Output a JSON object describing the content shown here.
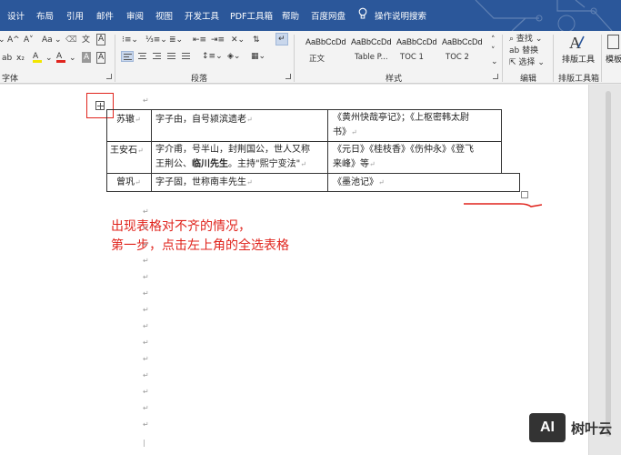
{
  "ribbon_tabs": [
    "设计",
    "布局",
    "引用",
    "邮件",
    "审阅",
    "视图",
    "开发工具",
    "PDF工具箱",
    "帮助",
    "百度网盘"
  ],
  "tell_me": "操作说明搜索",
  "font_group": {
    "label": "字体",
    "grow_label": "A^",
    "shrink_label": "A˅",
    "case_label": "Aa",
    "highlight_label": "A",
    "font_color_label": "A",
    "char_shade_label": "A",
    "char_border_label": "A"
  },
  "paragraph_group": {
    "label": "段落"
  },
  "styles_group": {
    "label": "样式",
    "styles": [
      {
        "sample": "AaBbCcDd",
        "name": "正文"
      },
      {
        "sample": "AaBbCcDd",
        "name": "Table P..."
      },
      {
        "sample": "AaBbCcDd",
        "name": "TOC 1"
      },
      {
        "sample": "AaBbCcDd",
        "name": "TOC 2"
      }
    ]
  },
  "editing_group": {
    "label": "编辑",
    "find": "查找",
    "replace": "替换",
    "select": "选择"
  },
  "layout_tools_group": {
    "label": "排版工具箱",
    "button": "排版工具",
    "next_button": "模板"
  },
  "para_mark": "↵",
  "table": {
    "rows": [
      {
        "name": "苏辙",
        "bio": "字子由，自号颍滨遗老",
        "bio_bold": "",
        "bio_rest": "",
        "works_line1": "《黄州快哉亭记》；《上枢密韩太尉",
        "works_line2": "书》"
      },
      {
        "name": "王安石",
        "bio": "字介甫，号半山，封荆国公，世人又称",
        "bio_line2_pre": "王荆公、",
        "bio_bold": "临川先生",
        "bio_rest": "。主持\"熙宁变法\"",
        "works_line1": "《元日》《桂枝香》《伤仲永》《登飞",
        "works_line2": "来峰》等"
      },
      {
        "name": "曾巩",
        "bio": "字子固，世称南丰先生",
        "works_line1": "《墨池记》"
      }
    ]
  },
  "annotation": {
    "line1": "出现表格对不齐的情况，",
    "line2": "第一步，点击左上角的全选表格"
  },
  "watermark": {
    "logo": "AI",
    "text": "树叶云"
  },
  "colors": {
    "ribbon_blue": "#2b579a",
    "annotation_red": "#e0241d"
  }
}
